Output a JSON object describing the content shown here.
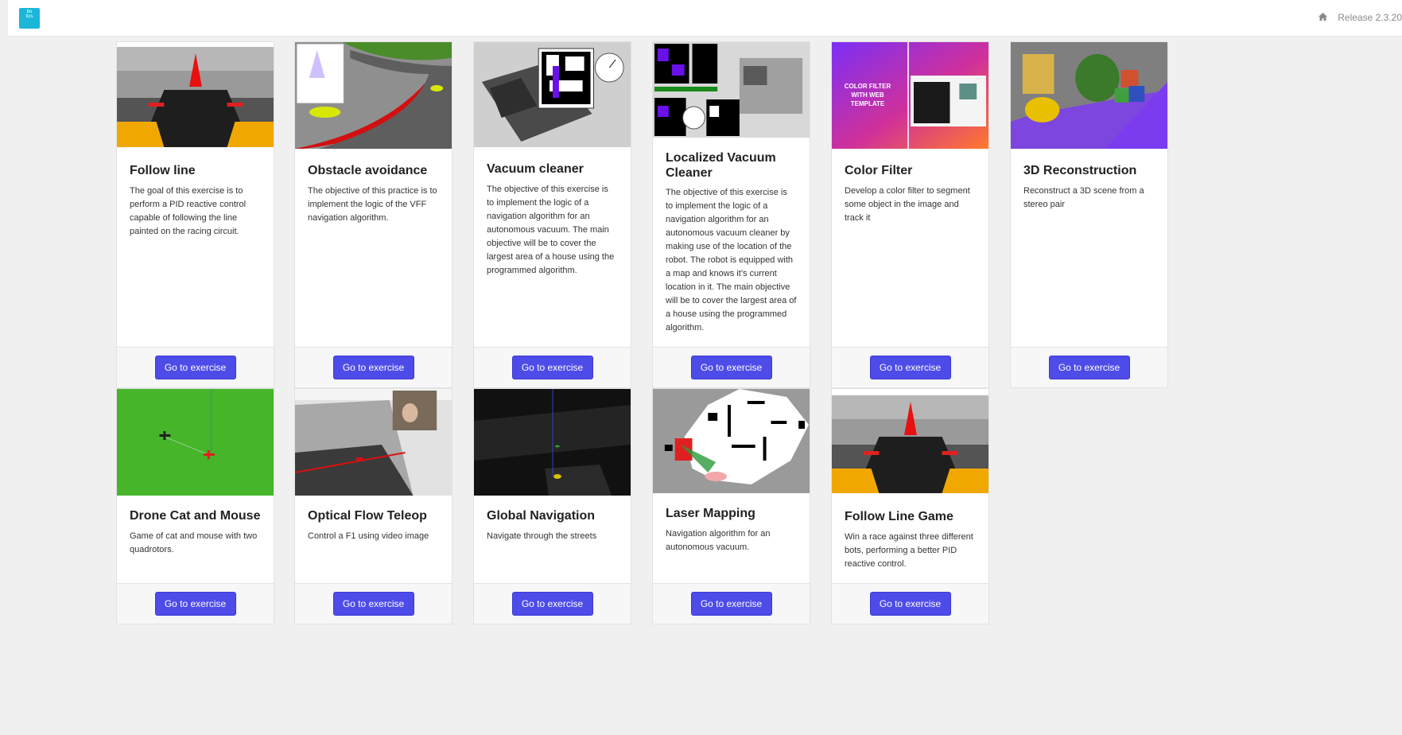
{
  "navbar": {
    "logo_text": [
      "",
      "bo",
      "tics"
    ],
    "release": "Release 2.3.20"
  },
  "exercises": [
    {
      "title": "Follow line",
      "description": "The goal of this exercise is to perform a PID reactive control capable of following the line painted on the racing circuit.",
      "button": "Go to exercise"
    },
    {
      "title": "Obstacle avoidance",
      "description": "The objective of this practice is to implement the logic of the VFF navigation algorithm.",
      "button": "Go to exercise"
    },
    {
      "title": "Vacuum cleaner",
      "description": "The objective of this exercise is to implement the logic of a navigation algorithm for an autonomous vacuum. The main objective will be to cover the largest area of a house using the programmed algorithm.",
      "button": "Go to exercise"
    },
    {
      "title": "Localized Vacuum Cleaner",
      "description": "The objective of this exercise is to implement the logic of a navigation algorithm for an autonomous vacuum cleaner by making use of the location of the robot. The robot is equipped with a map and knows it’s current location in it. The main objective will be to cover the largest area of a house using the programmed algorithm.",
      "button": "Go to exercise"
    },
    {
      "title": "Color Filter",
      "description": "Develop a color filter to segment some object in the image and track it",
      "button": "Go to exercise",
      "thumb_text": "COLOR FILTER WITH WEB TEMPLATE"
    },
    {
      "title": "3D Reconstruction",
      "description": "Reconstruct a 3D scene from a stereo pair",
      "button": "Go to exercise"
    },
    {
      "title": "Drone Cat and Mouse",
      "description": "Game of cat and mouse with two quadrotors.",
      "button": "Go to exercise"
    },
    {
      "title": "Optical Flow Teleop",
      "description": "Control a F1 using video image",
      "button": "Go to exercise"
    },
    {
      "title": "Global Navigation",
      "description": "Navigate through the streets",
      "button": "Go to exercise"
    },
    {
      "title": "Laser Mapping",
      "description": "Navigation algorithm for an autonomous vacuum.",
      "button": "Go to exercise"
    },
    {
      "title": "Follow Line Game",
      "description": "Win a race against three different bots, performing a better PID reactive control.",
      "button": "Go to exercise"
    }
  ],
  "icons": {
    "home": "home-icon",
    "logo": "robotics-logo"
  }
}
